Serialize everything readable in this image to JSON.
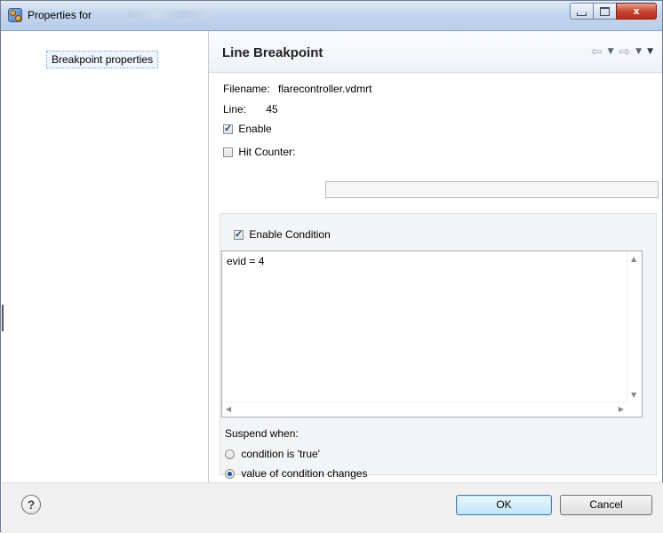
{
  "window": {
    "title": "Properties for",
    "controls": {
      "minimize": "minimize-icon",
      "maximize": "maximize-icon",
      "close_glyph": "x"
    }
  },
  "sidebar": {
    "items": [
      {
        "label": "Breakpoint properties",
        "selected": true
      }
    ]
  },
  "page": {
    "title": "Line Breakpoint",
    "nav": {
      "back_icon": "back-arrow-icon",
      "forward_icon": "forward-arrow-icon",
      "menu_icon": "view-menu-icon"
    }
  },
  "breakpoint": {
    "filename_label": "Filename:",
    "filename_value": "flarecontroller.vdmrt",
    "line_label": "Line:",
    "line_value": "45",
    "enable_label": "Enable",
    "enable_checked": true,
    "hit_counter_label": "Hit Counter:",
    "hit_counter_checked": false,
    "hit_counter_value": ""
  },
  "condition": {
    "enable_label": "Enable Condition",
    "enable_checked": true,
    "expression": "evid = 4",
    "suspend_label": "Suspend when:",
    "options": [
      {
        "label": "condition is 'true'",
        "selected": false
      },
      {
        "label": "value of condition changes",
        "selected": true
      }
    ]
  },
  "footer": {
    "help_icon": "help-icon",
    "help_glyph": "?",
    "ok_label": "OK",
    "cancel_label": "Cancel"
  }
}
